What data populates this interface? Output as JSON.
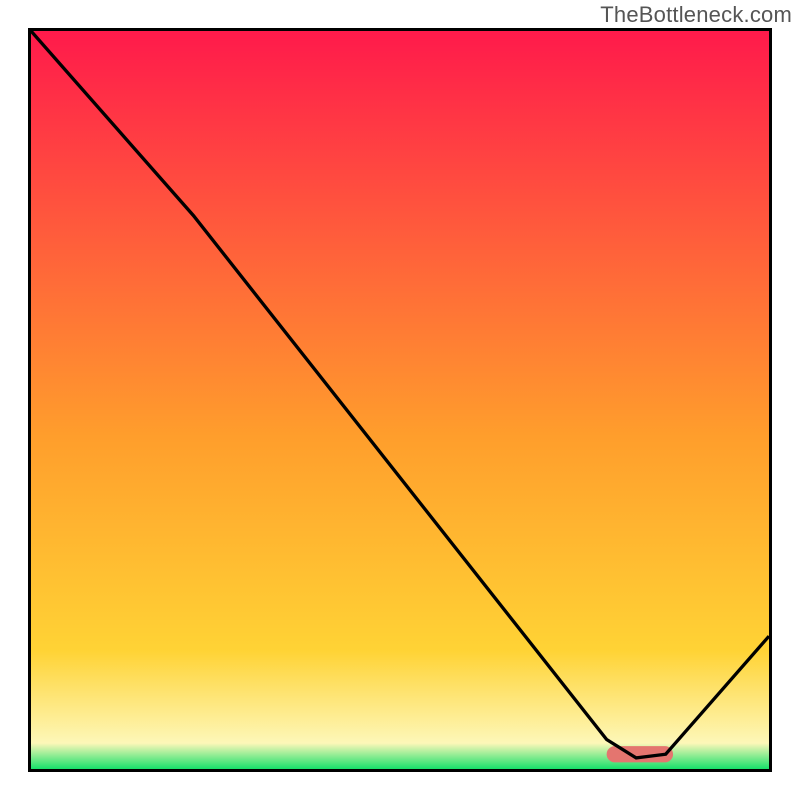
{
  "watermark": "TheBottleneck.com",
  "colors": {
    "border": "#000000",
    "grad_top": "#ff1a4b",
    "grad_mid_yellow": "#ffd335",
    "grad_pale": "#fdf7b8",
    "grad_green": "#17e06a",
    "curve": "#000000",
    "marker_fill": "#e4756f"
  },
  "chart_data": {
    "type": "line",
    "title": "",
    "xlabel": "",
    "ylabel": "",
    "xlim": [
      0,
      100
    ],
    "ylim": [
      0,
      100
    ],
    "series": [
      {
        "name": "bottleneck-curve",
        "x": [
          0,
          22,
          78,
          82,
          86,
          100
        ],
        "values": [
          100,
          75,
          4,
          1.5,
          2,
          18
        ]
      }
    ],
    "annotations": [
      {
        "name": "optimal-range-marker",
        "type": "pill",
        "x_range": [
          78,
          87
        ],
        "y": 2,
        "height": 2.2
      }
    ],
    "grid": false,
    "legend": false
  }
}
